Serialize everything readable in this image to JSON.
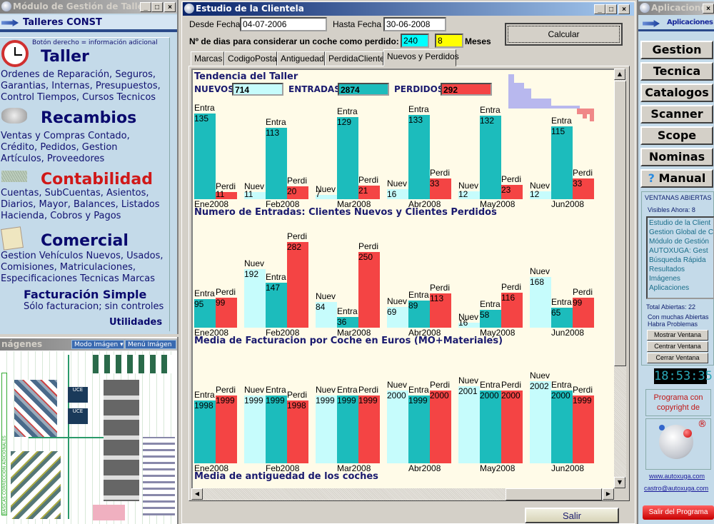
{
  "left_window": {
    "title": "Módulo de Gestión de Talleres",
    "heading": "Talleres CONST",
    "hint": "Botón derecho = información adicional",
    "sections": [
      {
        "title": "Taller",
        "icon": "clock-icon",
        "lines": [
          "Ordenes de Reparación, Seguros,",
          "Garantias, Internas, Presupuestos,",
          "Control Tiempos, Cursos Tecnicos"
        ]
      },
      {
        "title": "Recambios",
        "icon": "parts-icon",
        "lines": [
          "Ventas y Compras Contado,",
          "Crédito, Pedidos,  Gestion",
          "Artículos, Proveedores"
        ]
      },
      {
        "title": "Contabilidad",
        "icon": "money-icon",
        "lines": [
          "Cuentas, SubCuentas, Asientos,",
          "Diarios, Mayor, Balances, Listados",
          "Hacienda, Cobros y Pagos"
        ]
      },
      {
        "title": "Comercial",
        "icon": "notepad-icon",
        "lines": [
          "Gestion Vehículos Nuevos, Usados,",
          "Comisiones, Matriculaciones,",
          "Especificaciones Tecnicas Marcas"
        ]
      }
    ],
    "facturacion": {
      "title": "Facturación Simple",
      "sub": "Sólo facturacion; sin controles"
    },
    "utilidades": "Utilidades"
  },
  "images_window": {
    "title": "nágenes",
    "modo": "Modo Imágen",
    "menu": "Menú Imágen",
    "side_labels": [
      "BÁSICAS",
      "CORRECCIÓN",
      "ADICIONALES"
    ],
    "ucd_label": "UCE"
  },
  "main_window": {
    "title": "Estudio de la Clientela",
    "desde_label": "Desde Fecha",
    "desde_value": "04-07-2006",
    "hasta_label": "Hasta Fecha",
    "hasta_value": "30-06-2008",
    "dias_label": "Nº de dias para considerar un coche como perdido:",
    "dias_value": "240",
    "meses_value": "8",
    "meses_label": "Meses",
    "calcular": "Calcular",
    "salir": "Salir",
    "tabs": [
      "Marcas",
      "CodigoPostal",
      "Antiguedad",
      "PerdidaClientes",
      "Nuevos y Perdidos"
    ],
    "active_tab": "Nuevos y Perdidos",
    "summary": {
      "title": "Tendencia del Taller",
      "nuevos_label": "NUEVOS",
      "nuevos": "714",
      "entradas_label": "ENTRADAS",
      "entradas": "2874",
      "perdidos_label": "PERDIDOS",
      "perdidos": "292"
    }
  },
  "colors": {
    "nuevos": "#c6fcfc",
    "entradas": "#1cbcbc",
    "perdidos": "#f44444",
    "title": "#1a1a6e"
  },
  "chart_data": [
    {
      "type": "bar",
      "caption": "Numero de Entradas: Clientes Nuevos y Clientes Perdidos",
      "categories": [
        "Ene2008",
        "Feb2008",
        "Mar2008",
        "Abr2008",
        "May2008",
        "Jun2008"
      ],
      "series_labels": [
        "Nuev",
        "Entra",
        "Perdi"
      ],
      "series": [
        {
          "name": "Nuev",
          "values": [
            null,
            11,
            7,
            16,
            12,
            12
          ]
        },
        {
          "name": "Entra",
          "values": [
            135,
            113,
            129,
            133,
            132,
            115
          ]
        },
        {
          "name": "Perdi",
          "values": [
            11,
            20,
            21,
            33,
            23,
            33
          ]
        }
      ],
      "ylim": [
        0,
        135
      ]
    },
    {
      "type": "bar",
      "caption": "Media de Facturacion por Coche en Euros (MO+Materiales)",
      "categories": [
        "Ene2008",
        "Feb2008",
        "Mar2008",
        "Abr2008",
        "May2008",
        "Jun2008"
      ],
      "series": [
        {
          "name": "Nuev",
          "values": [
            null,
            192,
            84,
            69,
            16,
            168
          ]
        },
        {
          "name": "Entra",
          "values": [
            95,
            147,
            36,
            89,
            58,
            65
          ]
        },
        {
          "name": "Perdi",
          "values": [
            99,
            282,
            250,
            113,
            116,
            99
          ]
        }
      ],
      "ylim": [
        0,
        282
      ]
    },
    {
      "type": "bar",
      "caption": "Media de antiguedad de los coches",
      "categories": [
        "Ene2008",
        "Feb2008",
        "Mar2008",
        "Abr2008",
        "May2008",
        "Jun2008"
      ],
      "series": [
        {
          "name": "Nuev",
          "values": [
            null,
            1999,
            1999,
            2000,
            2001,
            2002
          ]
        },
        {
          "name": "Entra",
          "values": [
            1998,
            1999,
            1999,
            1999,
            2000,
            2000
          ]
        },
        {
          "name": "Perdi",
          "values": [
            1999,
            1998,
            1999,
            2000,
            2000,
            1999
          ]
        }
      ],
      "ylim": [
        1985,
        2003
      ]
    }
  ],
  "right_window": {
    "title": "Aplicaciones",
    "heading": "Aplicaciones",
    "buttons": [
      "Gestion",
      "Tecnica",
      "Catalogos",
      "Scanner",
      "Scope",
      "Nominas",
      "Manual"
    ],
    "ventanas_label": "VENTANAS ABIERTAS",
    "visibles": "Visibles Ahora: 8",
    "windows": [
      "Estudio de la Client",
      "Gestion Global de C",
      "Módulo de Gestión",
      "AUTOXUGA:  Gest",
      "Búsqueda Rápida",
      "Resultados",
      "Imágenes",
      "Aplicaciones"
    ],
    "total": "Total Abiertas: 22",
    "warn1": "Con muchas Abiertas",
    "warn2": "Habra Problemas",
    "mostrar": "Mostrar Ventana",
    "centrar": "Centrar Ventana",
    "cerrar": "Cerrar Ventana",
    "clock": "18:53:35",
    "copyright1": "Programa con",
    "copyright2": "copyright de",
    "web": "www.autoxuga.com",
    "email": "castro@autoxuga.com",
    "salir": "Salir del Programa"
  }
}
